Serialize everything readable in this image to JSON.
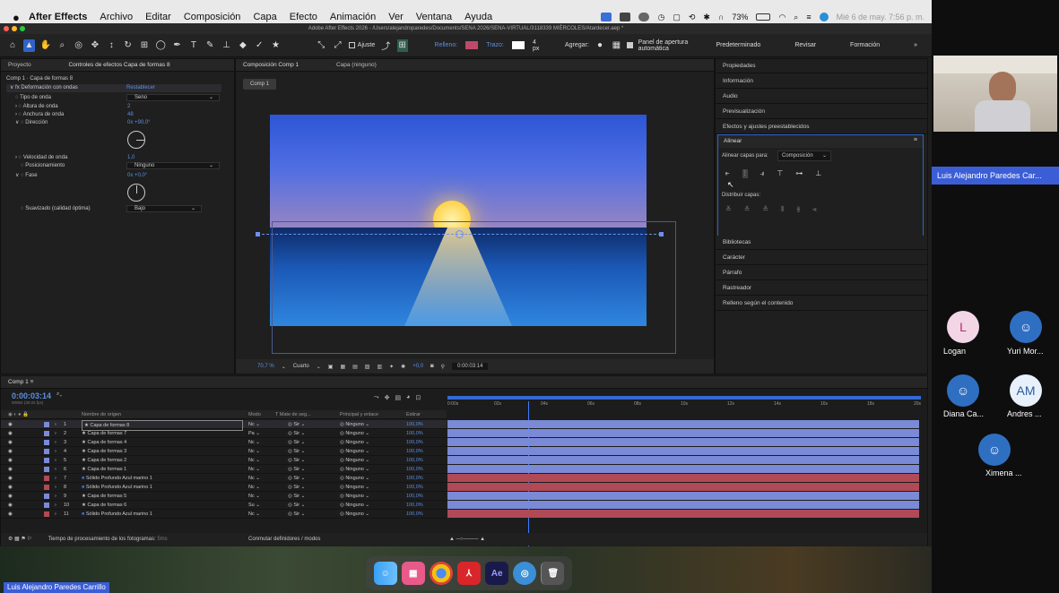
{
  "menubar": {
    "apple": "",
    "app": "After Effects",
    "items": [
      "Archivo",
      "Editar",
      "Composición",
      "Capa",
      "Efecto",
      "Animación",
      "Ver",
      "Ventana",
      "Ayuda"
    ],
    "battery": "73%",
    "datetime": "Mié 6 de may.  7:56 p. m."
  },
  "window": {
    "title": "Adobe After Effects 2026 - /Users/alejandroparedes/Documents/SENA 2026/SENA-VIRTUAL/3118339 MIÉRCOLES/Atardecer.aep *"
  },
  "toolbar": {
    "ajuste": "Ajuste",
    "relleno": "Relleno:",
    "trazo": "Trazo:",
    "trazo_px": "4 px",
    "agregar": "Agregar:",
    "panel_auto": "Panel de apertura automática",
    "workspaces": [
      "Predeterminado",
      "Revisar",
      "Formación"
    ],
    "more": "»",
    "relleno_color": "#c0496a"
  },
  "effects_panel": {
    "tab_project": "Proyecto",
    "tab_controls": "Controles de efectos Capa de formas 8",
    "layer": "Comp 1 · Capa de formas 8",
    "effect_name": "Deformación con ondas",
    "reset": "Restablecer",
    "props": [
      {
        "label": "Tipo de onda",
        "value": "Seno",
        "kind": "dropdown"
      },
      {
        "label": "Altura de onda",
        "value": "2",
        "kind": "num"
      },
      {
        "label": "Anchura de onda",
        "value": "48",
        "kind": "num"
      },
      {
        "label": "Dirección",
        "value": "0x +90,0°",
        "kind": "num"
      },
      {
        "label": "Velocidad de onda",
        "value": "1,0",
        "kind": "num"
      },
      {
        "label": "Posicionamiento",
        "value": "Ninguno",
        "kind": "dropdown"
      },
      {
        "label": "Fase",
        "value": "0x +0,0°",
        "kind": "num"
      },
      {
        "label": "Suavizado (calidad óptima)",
        "value": "Bajo",
        "kind": "dropdown"
      }
    ]
  },
  "comp_panel": {
    "tab": "Composición Comp 1",
    "layer_tab": "Capa (ninguno)",
    "comp_chip": "Comp 1",
    "zoom": "70,7 %",
    "quality": "Cuarto",
    "exposure": "+0,0",
    "timecode": "0:00:03:14"
  },
  "right_panel": {
    "top_items": [
      "Propiedades",
      "Información",
      "Audio",
      "Previsualización",
      "Efectos y ajustes preestablecidos"
    ],
    "align_title": "Alinear",
    "align_to_label": "Alinear capas para:",
    "align_to_value": "Composición",
    "distribute_label": "Distribuir capas:",
    "bottom_items": [
      "Bibliotecas",
      "Carácter",
      "Párrafo",
      "Rastreador",
      "Relleno según el contenido"
    ]
  },
  "timeline": {
    "tab": "Comp 1",
    "timecode": "0:00:03:14",
    "fps": "00094 (30.00 fps)",
    "headers": {
      "name": "Nombre de origen",
      "mode": "Modo",
      "track": "T  Mate de seg...",
      "parent": "Principal y enlace",
      "stretch": "Estirar"
    },
    "ruler": [
      "0:00s",
      "02s",
      "04s",
      "06s",
      "08s",
      "10s",
      "12s",
      "14s",
      "16s",
      "18s",
      "20s"
    ],
    "layers": [
      {
        "num": "1",
        "name": "Capa de formas 8",
        "mode": "Nc",
        "track": "Sir",
        "parent": "Ninguno",
        "stretch": "100,0%",
        "color": "#7a8ad6",
        "star": true,
        "selected": true
      },
      {
        "num": "2",
        "name": "Capa de formas 7",
        "mode": "Pa",
        "track": "Sir",
        "parent": "Ninguno",
        "stretch": "100,0%",
        "color": "#7a8ad6",
        "star": true
      },
      {
        "num": "3",
        "name": "Capa de formas 4",
        "mode": "Nc",
        "track": "Sir",
        "parent": "Ninguno",
        "stretch": "100,0%",
        "color": "#7a8ad6",
        "star": true
      },
      {
        "num": "4",
        "name": "Capa de formas 3",
        "mode": "Nc",
        "track": "Sir",
        "parent": "Ninguno",
        "stretch": "100,0%",
        "color": "#7a8ad6",
        "star": true
      },
      {
        "num": "5",
        "name": "Capa de formas 2",
        "mode": "Nc",
        "track": "Sir",
        "parent": "Ninguno",
        "stretch": "100,0%",
        "color": "#7a8ad6",
        "star": true
      },
      {
        "num": "6",
        "name": "Capa de formas 1",
        "mode": "Nc",
        "track": "Sir",
        "parent": "Ninguno",
        "stretch": "100,0%",
        "color": "#7a8ad6",
        "star": true
      },
      {
        "num": "7",
        "name": "Sólido Profundo Azul marino 1",
        "mode": "Nc",
        "track": "Sir",
        "parent": "Ninguno",
        "stretch": "100,0%",
        "color": "#b04a56",
        "star": false
      },
      {
        "num": "8",
        "name": "Sólido Profundo Azul marino 1",
        "mode": "Nc",
        "track": "Sir",
        "parent": "Ninguno",
        "stretch": "100,0%",
        "color": "#b04a56",
        "star": false
      },
      {
        "num": "9",
        "name": "Capa de formas 5",
        "mode": "Nc",
        "track": "Sir",
        "parent": "Ninguno",
        "stretch": "100,0%",
        "color": "#7a8ad6",
        "star": true
      },
      {
        "num": "10",
        "name": "Capa de formas 6",
        "mode": "Su",
        "track": "Sir",
        "parent": "Ninguno",
        "stretch": "100,0%",
        "color": "#7a8ad6",
        "star": true
      },
      {
        "num": "11",
        "name": "Sólido Profundo Azul marino 1",
        "mode": "Nc",
        "track": "Sir",
        "parent": "Ninguno",
        "stretch": "100,0%",
        "color": "#b04a56",
        "star": false
      }
    ],
    "footer_render": "Tiempo de procesamiento de los fotogramas:",
    "footer_render_val": "5ms",
    "footer_toggle": "Conmutar definidores / modos"
  },
  "dock": {
    "icons": [
      "finder-icon",
      "launchpad-icon",
      "chrome-icon",
      "acrobat-icon",
      "after-effects-icon",
      "quicktime-icon",
      "trash-icon"
    ],
    "ae_label": "Ae"
  },
  "meeting": {
    "bottom_name": "Luis Alejandro Paredes Carrillo",
    "speaker_name": "Luis Alejandro Paredes Car...",
    "participants": [
      {
        "initial": "L",
        "name": "Logan",
        "bg": "#f3d6e6",
        "fg": "#b0306e"
      },
      {
        "initial": "",
        "name": "Yuri Mor...",
        "bg": "#2f6fc2",
        "fg": "#ffffff"
      },
      {
        "initial": "",
        "name": "Diana Ca...",
        "bg": "#2f6fc2",
        "fg": "#ffffff"
      },
      {
        "initial": "AM",
        "name": "Andres ...",
        "bg": "#e8f1fb",
        "fg": "#2b5a9a"
      },
      {
        "initial": "",
        "name": "Ximena ...",
        "bg": "#2f6fc2",
        "fg": "#ffffff"
      }
    ]
  }
}
